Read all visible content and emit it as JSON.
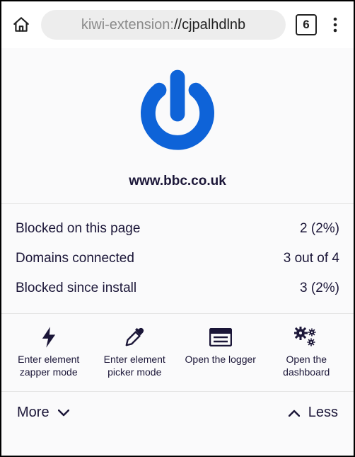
{
  "browser": {
    "url_prefix": "kiwi-extension:",
    "url_rest": "//cjpalhdlnb",
    "tab_count": "6"
  },
  "popup": {
    "site": "www.bbc.co.uk",
    "stats": [
      {
        "label": "Blocked on this page",
        "value": "2 (2%)"
      },
      {
        "label": "Domains connected",
        "value": "3 out of 4"
      },
      {
        "label": "Blocked since install",
        "value": "3 (2%)"
      }
    ],
    "tools": [
      {
        "label": "Enter element zapper mode"
      },
      {
        "label": "Enter element picker mode"
      },
      {
        "label": "Open the logger"
      },
      {
        "label": "Open the dashboard"
      }
    ],
    "more_label": "More",
    "less_label": "Less"
  }
}
